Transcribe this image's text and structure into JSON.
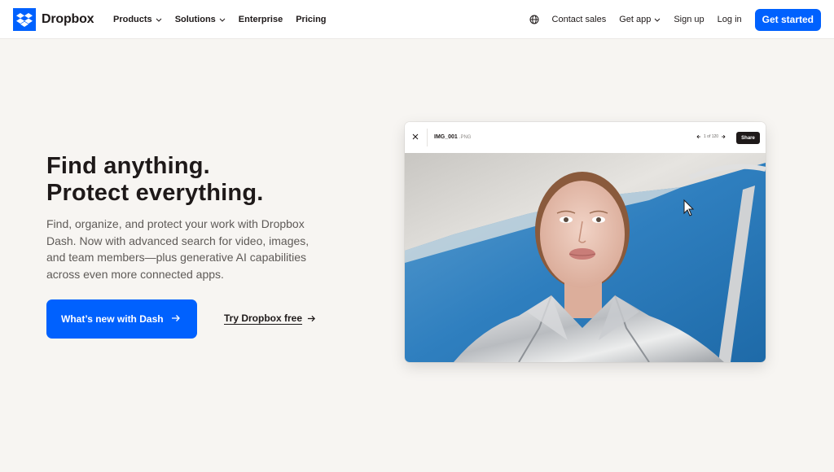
{
  "brand": {
    "name": "Dropbox",
    "logo_icon": "dropbox-logo-icon",
    "accent": "#0061fe"
  },
  "nav": {
    "left": [
      {
        "label": "Products",
        "dropdown": true
      },
      {
        "label": "Solutions",
        "dropdown": true
      },
      {
        "label": "Enterprise",
        "dropdown": false
      },
      {
        "label": "Pricing",
        "dropdown": false
      }
    ],
    "language_icon": "globe-icon",
    "contact_sales": "Contact sales",
    "get_app": "Get app",
    "sign_up": "Sign up",
    "log_in": "Log in",
    "cta": "Get started"
  },
  "hero": {
    "title_line1": "Find anything.",
    "title_line2": "Protect everything.",
    "description": "Find, organize, and protect your work with Dropbox Dash. Now with advanced search for video, images, and team members—plus generative AI capabilities across even more connected apps.",
    "primary_button": "What’s new with Dash",
    "secondary_link": "Try Dropbox free"
  },
  "preview": {
    "file_name": "IMG_001",
    "file_ext": ".PNG",
    "pager": "1 of 120",
    "share": "Share",
    "image": "photo-of-woman-in-silver-jacket-against-blue-sky"
  }
}
